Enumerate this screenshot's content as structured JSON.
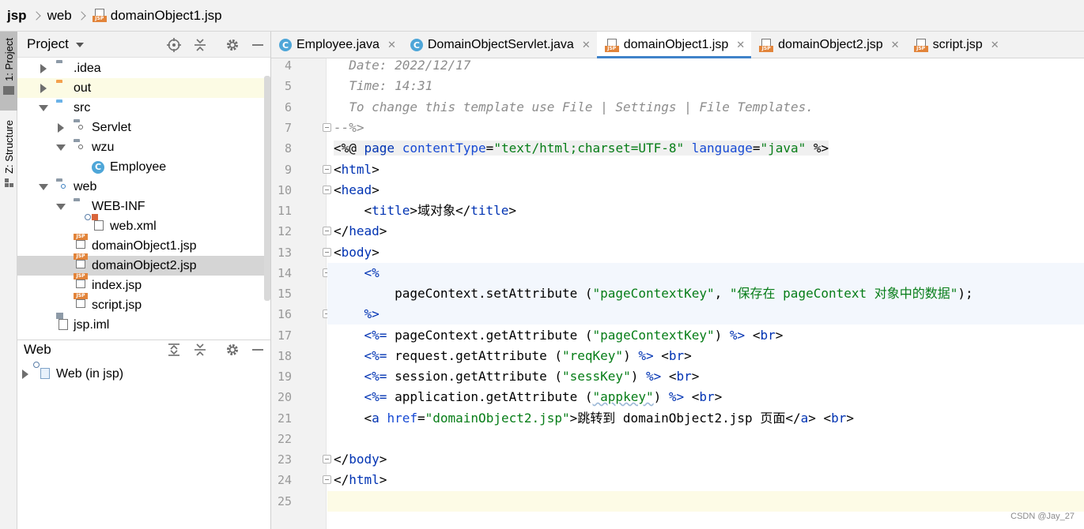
{
  "breadcrumb": [
    "jsp",
    "web",
    "domainObject1.jsp"
  ],
  "tool_strip": {
    "project_tab": "1: Project",
    "structure_tab": "Z: Structure"
  },
  "project_panel": {
    "title": "Project",
    "tree": [
      {
        "label": ".idea",
        "icon": "folder-icon",
        "state": "collapsed"
      },
      {
        "label": "out",
        "icon": "folder-orange-icon",
        "state": "collapsed"
      },
      {
        "label": "src",
        "icon": "folder-source-icon",
        "state": "expanded"
      },
      {
        "label": "Servlet",
        "icon": "package-icon",
        "state": "collapsed"
      },
      {
        "label": "wzu",
        "icon": "package-icon",
        "state": "expanded"
      },
      {
        "label": "Employee",
        "icon": "class-icon",
        "state": "leaf"
      },
      {
        "label": "web",
        "icon": "web-folder-icon",
        "state": "expanded"
      },
      {
        "label": "WEB-INF",
        "icon": "folder-icon",
        "state": "expanded"
      },
      {
        "label": "web.xml",
        "icon": "xml-file-icon",
        "state": "leaf"
      },
      {
        "label": "domainObject1.jsp",
        "icon": "jsp-file-icon",
        "state": "leaf"
      },
      {
        "label": "domainObject2.jsp",
        "icon": "jsp-file-icon",
        "state": "leaf"
      },
      {
        "label": "index.jsp",
        "icon": "jsp-file-icon",
        "state": "leaf"
      },
      {
        "label": "script.jsp",
        "icon": "jsp-file-icon",
        "state": "leaf"
      },
      {
        "label": "jsp.iml",
        "icon": "iml-file-icon",
        "state": "leaf"
      }
    ]
  },
  "web_panel": {
    "title": "Web",
    "items": [
      {
        "label": "Web (in jsp)"
      }
    ]
  },
  "tabs": [
    {
      "label": "Employee.java",
      "icon": "class-icon",
      "active": false
    },
    {
      "label": "DomainObjectServlet.java",
      "icon": "class-icon",
      "active": false
    },
    {
      "label": "domainObject1.jsp",
      "icon": "jsp-file-icon",
      "active": true
    },
    {
      "label": "domainObject2.jsp",
      "icon": "jsp-file-icon",
      "active": false
    },
    {
      "label": "script.jsp",
      "icon": "jsp-file-icon",
      "active": false
    }
  ],
  "editor": {
    "line_numbers": [
      "4",
      "5",
      "6",
      "7",
      "8",
      "9",
      "10",
      "11",
      "12",
      "13",
      "14",
      "15",
      "16",
      "17",
      "18",
      "19",
      "20",
      "21",
      "22",
      "23",
      "24",
      "25"
    ],
    "lines": {
      "l4": "  Date: 2022/12/17",
      "l5": "  Time: 14:31",
      "l6": "  To change this template use File | Settings | File Templates.",
      "l7": "--%>",
      "l8_open": "<%@ ",
      "l8_kw": "page",
      "l8_attr1": "contentType",
      "l8_eq1": "=",
      "l8_val1": "\"text/html;charset=UTF-8\"",
      "l8_attr2": "language",
      "l8_eq2": "=",
      "l8_val2": "\"java\"",
      "l8_close": " %>",
      "l9_lt": "<",
      "l9_tag": "html",
      "l9_gt": ">",
      "l10_lt": "<",
      "l10_tag": "head",
      "l10_gt": ">",
      "l11_open": "    <",
      "l11_tag1": "title",
      "l11_text": ">域对象</",
      "l11_tag2": "title",
      "l11_gt": ">",
      "l12_lt": "</",
      "l12_tag": "head",
      "l12_gt": ">",
      "l13_lt": "<",
      "l13_tag": "body",
      "l13_gt": ">",
      "l14": "    <%",
      "l15_code": "        pageContext.setAttribute (",
      "l15_s1": "\"pageContextKey\"",
      "l15_comma": ", ",
      "l15_s2": "\"保存在 pageContext 对象中的数据\"",
      "l15_end": ");",
      "l16": "    %>",
      "l17_open": "    <%=",
      "l17_code": " pageContext.getAttribute (",
      "l17_s": "\"pageContextKey\"",
      "l17_rp": ") ",
      "l17_close": "%>",
      "l17_br": " <",
      "l17_brtag": "br",
      "l17_brgt": ">",
      "l18_open": "    <%=",
      "l18_code": " request.getAttribute (",
      "l18_s": "\"reqKey\"",
      "l18_rp": ") ",
      "l18_close": "%>",
      "l18_br": " <",
      "l18_brtag": "br",
      "l18_brgt": ">",
      "l19_open": "    <%=",
      "l19_code": " session.getAttribute (",
      "l19_s": "\"sessKey\"",
      "l19_rp": ") ",
      "l19_close": "%>",
      "l19_br": " <",
      "l19_brtag": "br",
      "l19_brgt": ">",
      "l20_open": "    <%=",
      "l20_code": " application.getAttribute (",
      "l20_s": "\"appkey\"",
      "l20_rp": ") ",
      "l20_close": "%>",
      "l20_br": " <",
      "l20_brtag": "br",
      "l20_brgt": ">",
      "l21_open": "    <",
      "l21_tag": "a",
      "l21_attr": " href",
      "l21_eq": "=",
      "l21_val": "\"domainObject2.jsp\"",
      "l21_text": ">跳转到 domainObject2.jsp 页面</",
      "l21_tag2": "a",
      "l21_gt": "> <",
      "l21_br": "br",
      "l21_gt2": ">",
      "l23_lt": "</",
      "l23_tag": "body",
      "l23_gt": ">",
      "l24_lt": "</",
      "l24_tag": "html",
      "l24_gt": ">"
    }
  },
  "watermark": "CSDN @Jay_27",
  "colors": {
    "tag": "#0033b3",
    "string": "#067d17",
    "comment": "#8c8c8c",
    "selection": "#d5d5d5",
    "active_tab_underline": "#4083c9"
  }
}
